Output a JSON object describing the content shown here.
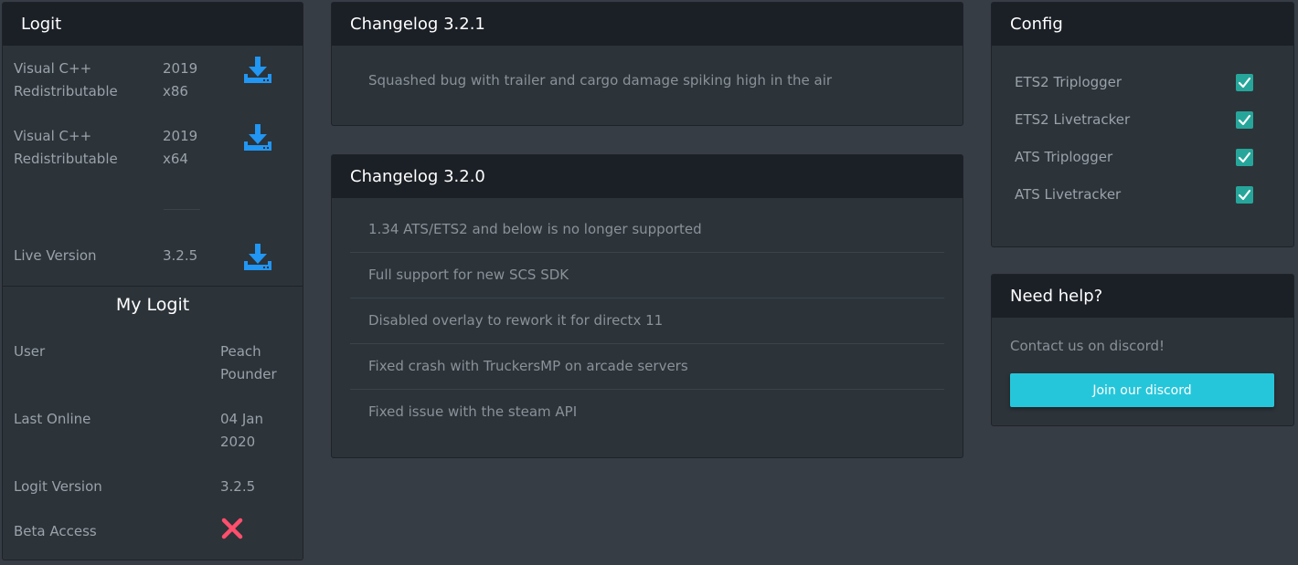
{
  "logit": {
    "title": "Logit",
    "downloads": [
      {
        "name": "Visual C++ Redistributable",
        "version": "2019 x86",
        "icon": "download-icon"
      },
      {
        "name": "Visual C++ Redistributable",
        "version": "2019 x64",
        "icon": "download-icon"
      },
      {
        "name": "Live Version",
        "version": "3.2.5",
        "icon": "download-icon"
      }
    ]
  },
  "mylogit": {
    "title": "My Logit",
    "user_label": "User",
    "user_value": "Peach Pounder",
    "last_online_label": "Last Online",
    "last_online_value": "04 Jan 2020",
    "version_label": "Logit Version",
    "version_value": "3.2.5",
    "beta_label": "Beta Access",
    "beta_icon": "cross-icon"
  },
  "changelog_321": {
    "title": "Changelog 3.2.1",
    "items": [
      "Squashed bug with trailer and cargo damage spiking high in the air"
    ]
  },
  "changelog_320": {
    "title": "Changelog 3.2.0",
    "items": [
      "1.34 ATS/ETS2 and below is no longer supported",
      "Full support for new SCS SDK",
      "Disabled overlay to rework it for directx 11",
      "Fixed crash with TruckersMP on arcade servers",
      "Fixed issue with the steam API"
    ]
  },
  "config": {
    "title": "Config",
    "items": [
      {
        "label": "ETS2 Triplogger",
        "checked": true
      },
      {
        "label": "ETS2 Livetracker",
        "checked": true
      },
      {
        "label": "ATS Triplogger",
        "checked": true
      },
      {
        "label": "ATS Livetracker",
        "checked": true
      }
    ]
  },
  "help": {
    "title": "Need help?",
    "text": "Contact us on discord!",
    "button_label": "Join our discord"
  },
  "colors": {
    "background": "#373d45",
    "card": "#2c3339",
    "card_header": "#1b1f26",
    "download_blue": "#2196f3",
    "checkbox_teal": "#26a69a",
    "button_cyan": "#26c6da",
    "cross_red": "#ff4f6d"
  }
}
